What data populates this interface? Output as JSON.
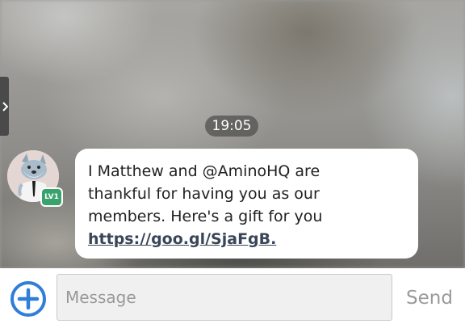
{
  "chat": {
    "timestamp": "19:05",
    "message": {
      "lines": [
        "I Matthew and @AminoHQ are",
        "thankful for having you as our",
        "members. Here's a gift for you"
      ],
      "link": "https://goo.gl/SjaFgB."
    },
    "sender": {
      "level_badge": "LV1"
    }
  },
  "composer": {
    "input_placeholder": "Message",
    "input_value": "",
    "send_label": "Send"
  },
  "icons": {
    "side_handle": "chevron-right-icon",
    "add": "plus-circle-icon"
  },
  "colors": {
    "accent": "#2f7ed8",
    "level_badge": "#3aa36b",
    "link": "#3a4658"
  }
}
